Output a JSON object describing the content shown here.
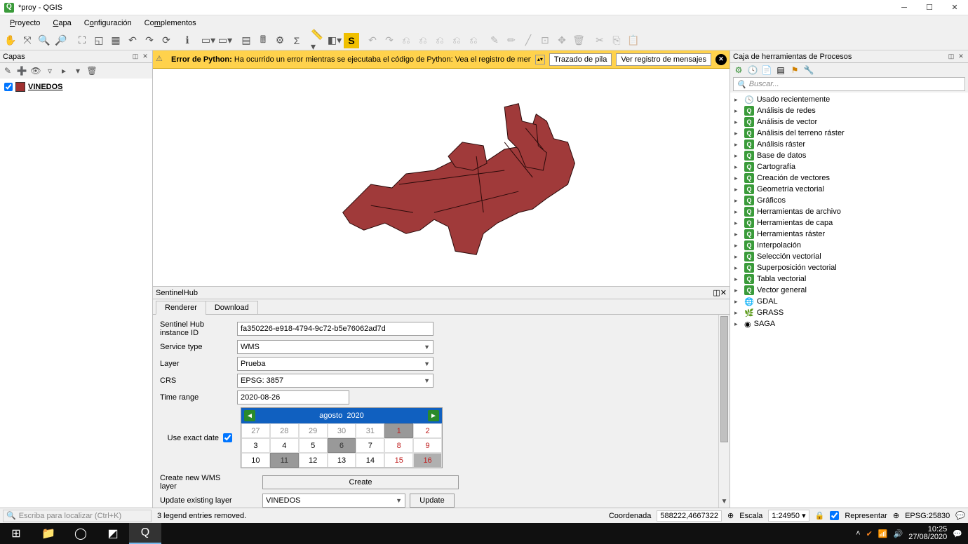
{
  "window": {
    "title": "*proy - QGIS"
  },
  "menu": {
    "items": [
      "Proyecto",
      "Capa",
      "Configuración",
      "Complementos"
    ]
  },
  "layers_panel": {
    "title": "Capas",
    "layer": {
      "name": "VINEDOS",
      "checked": true,
      "color": "#a03030"
    }
  },
  "error_bar": {
    "title": "Error de Python:",
    "msg": "Ha ocurrido un error mientras se ejecutaba el código de Python: Vea el registro de mensajes (Error de",
    "btn_trace": "Trazado de pila",
    "btn_log": "Ver registro de mensajes"
  },
  "sentinel": {
    "title": "SentinelHub",
    "tabs": {
      "renderer": "Renderer",
      "download": "Download"
    },
    "instance_label": "Sentinel Hub instance ID",
    "instance_value": "fa350226-e918-4794-9c72-b5e76062ad7d",
    "service_label": "Service type",
    "service_value": "WMS",
    "layer_label": "Layer",
    "layer_value": "Prueba",
    "crs_label": "CRS",
    "crs_value": "EPSG: 3857",
    "time_label": "Time range",
    "time_value": "2020-08-26",
    "exact_label": "Use exact date",
    "cal_month": "agosto",
    "cal_year": "2020",
    "create_label": "Create new WMS layer",
    "create_btn": "Create",
    "update_label": "Update existing layer",
    "update_value": "VINEDOS",
    "update_btn": "Update"
  },
  "processing": {
    "title": "Caja de herramientas de Procesos",
    "search_placeholder": "Buscar...",
    "recent": "Usado recientemente",
    "items": [
      "Análisis de redes",
      "Análisis de vector",
      "Análisis del terreno ráster",
      "Análisis ráster",
      "Base de datos",
      "Cartografía",
      "Creación de vectores",
      "Geometría vectorial",
      "Gráficos",
      "Herramientas de archivo",
      "Herramientas de capa",
      "Herramientas ráster",
      "Interpolación",
      "Selección vectorial",
      "Superposición vectorial",
      "Tabla vectorial",
      "Vector general"
    ],
    "providers": [
      "GDAL",
      "GRASS",
      "SAGA"
    ]
  },
  "statusbar": {
    "locator_placeholder": "Escriba para localizar (Ctrl+K)",
    "legend_msg": "3 legend entries removed.",
    "coord_label": "Coordenada",
    "coord_value": "588222,4667322",
    "scale_label": "Escala",
    "scale_value": "1:24950",
    "render_label": "Representar",
    "epsg": "EPSG:25830"
  },
  "taskbar": {
    "time": "10:25",
    "date": "27/08/2020"
  }
}
